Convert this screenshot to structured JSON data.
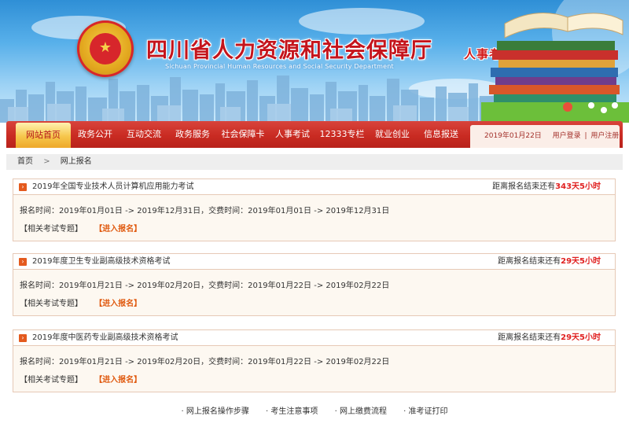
{
  "header": {
    "title": "四川省人力资源和社会保障厅",
    "subtitle": "Sichuan Provincial Human Resources and Social Security Department",
    "special": "人事考试专栏"
  },
  "nav": {
    "tabs": [
      {
        "label": "网站首页",
        "active": true
      },
      {
        "label": "政务公开",
        "active": false
      },
      {
        "label": "互动交流",
        "active": false
      },
      {
        "label": "政务服务",
        "active": false
      },
      {
        "label": "社会保障卡",
        "active": false
      },
      {
        "label": "人事考试",
        "active": false
      },
      {
        "label": "12333专栏",
        "active": false
      },
      {
        "label": "就业创业",
        "active": false
      },
      {
        "label": "信息报送",
        "active": false
      }
    ],
    "date": "2019年01月22日",
    "login": "用户登录",
    "register": "用户注册",
    "separator": "|"
  },
  "breadcrumb": {
    "home": "首页",
    "chevron": ">",
    "current": "网上报名"
  },
  "exams": [
    {
      "title": "2019年全国专业技术人员计算机应用能力考试",
      "countdown_prefix": "距离报名结束还有",
      "countdown_value": "343天5小时",
      "time": "报名时间：2019年01月01日 -> 2019年12月31日，交费时间：2019年01月01日 -> 2019年12月31日",
      "link_topic": "【相关考试专题】",
      "link_enter": "【进入报名】"
    },
    {
      "title": "2019年度卫生专业副高级技术资格考试",
      "countdown_prefix": "距离报名结束还有",
      "countdown_value": "29天5小时",
      "time": "报名时间：2019年01月21日 -> 2019年02月20日，交费时间：2019年01月22日 -> 2019年02月22日",
      "link_topic": "【相关考试专题】",
      "link_enter": "【进入报名】"
    },
    {
      "title": "2019年度中医药专业副高级技术资格考试",
      "countdown_prefix": "距离报名结束还有",
      "countdown_value": "29天5小时",
      "time": "报名时间：2019年01月21日 -> 2019年02月20日，交费时间：2019年01月22日 -> 2019年02月22日",
      "link_topic": "【相关考试专题】",
      "link_enter": "【进入报名】"
    }
  ],
  "footer": {
    "bullet": "·",
    "links": [
      "网上报名操作步骤",
      "考生注意事项",
      "网上缴费流程",
      "准考证打印"
    ]
  },
  "colors": {
    "nav_red": "#c92b22",
    "active_tab": "#f6c64b",
    "accent_orange": "#e45a1e",
    "countdown_red": "#e02020"
  }
}
